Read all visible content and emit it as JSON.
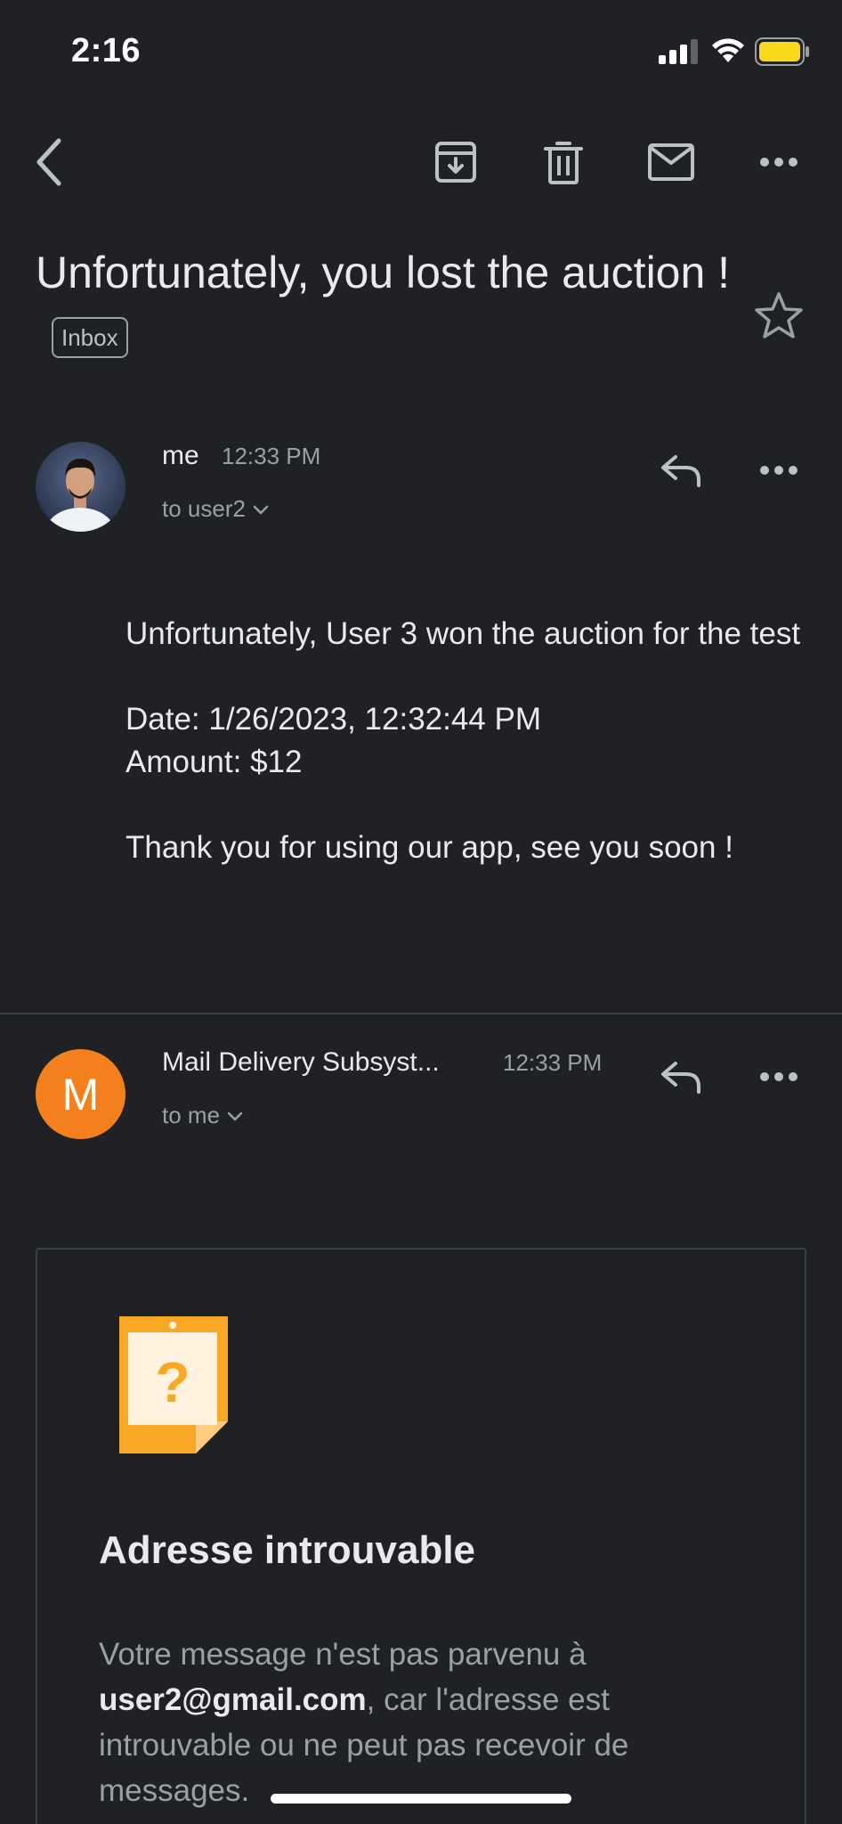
{
  "status_bar": {
    "time": "2:16"
  },
  "toolbar": {
    "back_icon": "chevron-left-icon",
    "archive_icon": "archive-icon",
    "delete_icon": "trash-icon",
    "unread_icon": "mail-icon",
    "more_icon": "more-horizontal-icon"
  },
  "subject": {
    "title": "Unfortunately, you lost the auction !",
    "label": "Inbox"
  },
  "message1": {
    "sender": "me",
    "time": "12:33 PM",
    "to": "to user2",
    "body": {
      "line1": "Unfortunately, User 3 won the auction for the test",
      "date": "Date: 1/26/2023, 12:32:44 PM",
      "amount": "Amount: $12",
      "thanks": "Thank you for using our app, see you soon !"
    }
  },
  "message2": {
    "avatar_letter": "M",
    "avatar_color": "#f4801d",
    "sender": "Mail Delivery Subsyst...",
    "time": "12:33 PM",
    "to": "to me",
    "card": {
      "title": "Adresse introuvable",
      "text_before": "Votre message n'est pas parvenu à ",
      "email": "user2@gmail.com",
      "text_after": ", car l'adresse est introuvable ou ne peut pas recevoir de messages."
    }
  }
}
